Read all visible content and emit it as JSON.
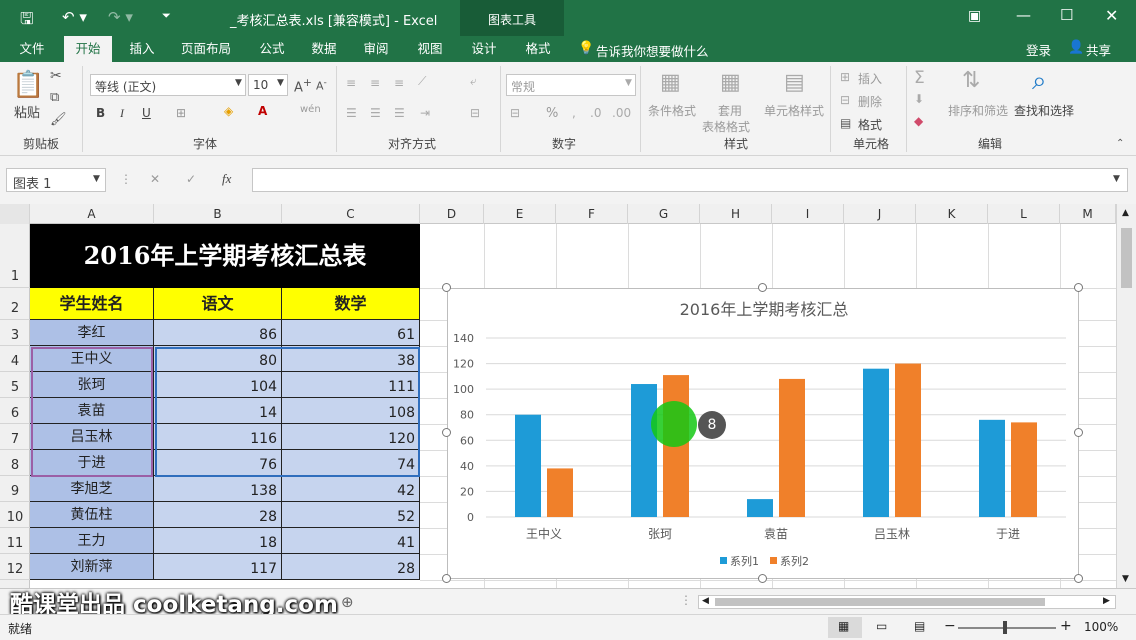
{
  "titlebar": {
    "title": "_考核汇总表.xls  [兼容模式] - Excel",
    "chart_tools": "图表工具"
  },
  "tabs": [
    "文件",
    "开始",
    "插入",
    "页面布局",
    "公式",
    "数据",
    "审阅",
    "视图",
    "设计",
    "格式"
  ],
  "tell_me": "告诉我你想要做什么",
  "login": "登录",
  "share": "共享",
  "ribbon": {
    "paste": "粘贴",
    "clipboard": "剪贴板",
    "font_name": "等线 (正文)",
    "font_size": "10",
    "font_group": "字体",
    "align_group": "对齐方式",
    "number_format": "常规",
    "number_group": "数字",
    "cond_format": "条件格式",
    "table_format_1": "套用",
    "table_format_2": "表格格式",
    "cell_styles": "单元格样式",
    "styles_group": "样式",
    "insert": "插入",
    "delete": "删除",
    "format": "格式",
    "cells_group": "单元格",
    "sort_filter": "排序和筛选",
    "find_select": "查找和选择",
    "edit_group": "编辑",
    "bold": "B",
    "italic": "I",
    "underline": "U",
    "wen": "wén",
    "percent": "%"
  },
  "formula": {
    "name_box": "图表 1",
    "fx": "fx",
    "cancel": "✕",
    "enter": "✓",
    "value": ""
  },
  "columns": [
    "A",
    "B",
    "C",
    "D",
    "E",
    "F",
    "G",
    "H",
    "I",
    "J",
    "K",
    "L",
    "M"
  ],
  "rows": [
    "1",
    "2",
    "3",
    "4",
    "5",
    "6",
    "7",
    "8",
    "9",
    "10",
    "11",
    "12"
  ],
  "sheet_title": "2016年上学期考核汇总表",
  "table_headers": [
    "学生姓名",
    "语文",
    "数学"
  ],
  "table_rows": [
    [
      "李红",
      "86",
      "61"
    ],
    [
      "王中义",
      "80",
      "38"
    ],
    [
      "张珂",
      "104",
      "111"
    ],
    [
      "袁苗",
      "14",
      "108"
    ],
    [
      "吕玉林",
      "116",
      "120"
    ],
    [
      "于进",
      "76",
      "74"
    ],
    [
      "李旭芝",
      "138",
      "42"
    ],
    [
      "黄伍柱",
      "28",
      "52"
    ],
    [
      "王力",
      "18",
      "41"
    ],
    [
      "刘新萍",
      "117",
      "28"
    ]
  ],
  "click_badge": "8",
  "watermark": "酷课堂出品 coolketang.com",
  "statusbar": {
    "ready": "就绪",
    "zoom": "100%",
    "plus": "+",
    "minus": "−"
  },
  "chart_data": {
    "type": "bar",
    "title": "2016年上学期考核汇总",
    "categories": [
      "王中义",
      "张珂",
      "袁苗",
      "吕玉林",
      "于进"
    ],
    "series": [
      {
        "name": "系列1",
        "values": [
          80,
          104,
          14,
          116,
          76
        ],
        "color": "#1e9bd7"
      },
      {
        "name": "系列2",
        "values": [
          38,
          111,
          108,
          120,
          74
        ],
        "color": "#f0802a"
      }
    ],
    "ylim": [
      0,
      140
    ],
    "yticks": [
      "0",
      "20",
      "40",
      "60",
      "80",
      "100",
      "120",
      "140"
    ],
    "legend": "bottom",
    "grid": true
  }
}
